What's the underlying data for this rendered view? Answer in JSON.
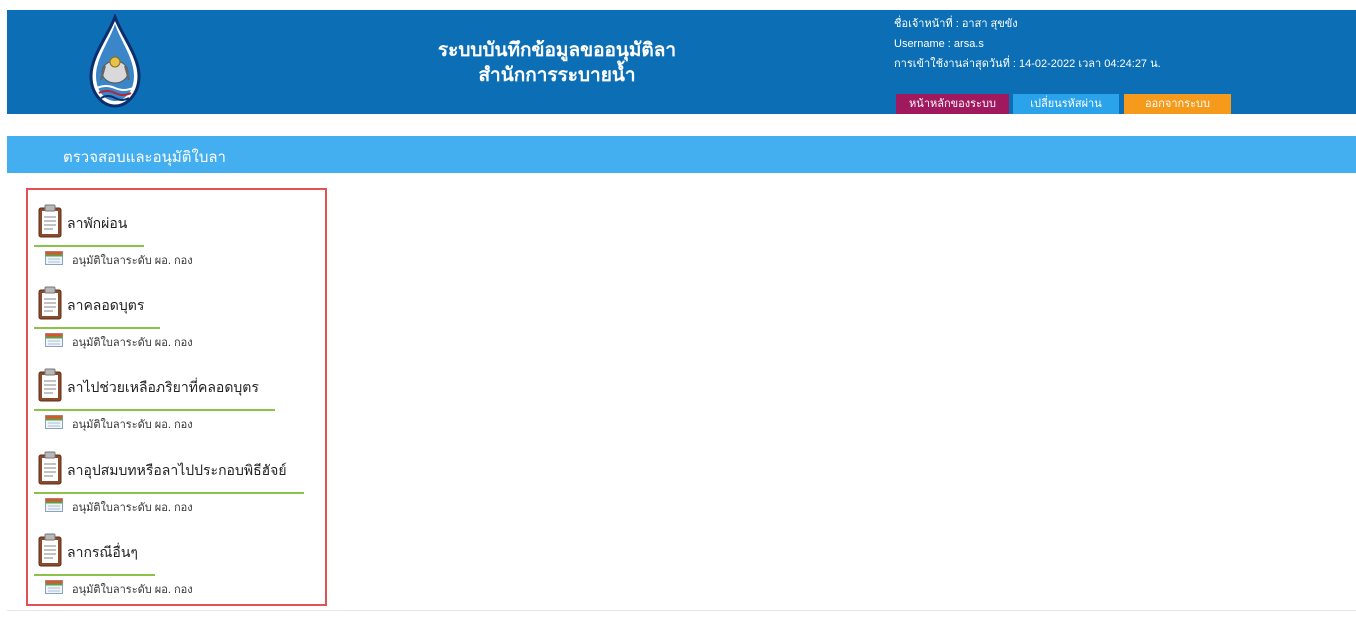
{
  "header": {
    "title_line1": "ระบบบันทึกข้อมูลขออนุมัติลา",
    "title_line2": "สำนักการระบายน้ำ",
    "officer_label": "ชื่อเจ้าหน้าที่ : อาสา  สุขขัง",
    "username_label": "Username : arsa.s",
    "last_login_label": "การเข้าใช้งานล่าสุดวันที่ : 14-02-2022 เวลา 04:24:27 น.",
    "nav": {
      "home": "หน้าหลักของระบบ",
      "change_password": "เปลี่ยนรหัสผ่าน",
      "logout": "ออกจากระบบ"
    }
  },
  "section": {
    "title": "ตรวจสอบและอนุมัติใบลา"
  },
  "leave_types": [
    {
      "label": "ลาพักผ่อน",
      "approve_label": "อนุมัติใบลาระดับ ผอ. กอง"
    },
    {
      "label": "ลาคลอดบุตร",
      "approve_label": "อนุมัติใบลาระดับ ผอ. กอง"
    },
    {
      "label": "ลาไปช่วยเหลือภริยาที่คลอดบุตร",
      "approve_label": "อนุมัติใบลาระดับ ผอ. กอง"
    },
    {
      "label": "ลาอุปสมบทหรือลาไปประกอบพิธีฮัจย์",
      "approve_label": "อนุมัติใบลาระดับ ผอ. กอง"
    },
    {
      "label": "ลากรณีอื่นๆ",
      "approve_label": "อนุมัติใบลาระดับ ผอ. กอง"
    }
  ],
  "colors": {
    "header_bg": "#0c6fb5",
    "section_bg": "#43aef0",
    "home_button": "#a0185e",
    "password_button": "#2aa3ea",
    "logout_button": "#f59a1b",
    "highlight_border": "#e05353",
    "underline": "#8bc34a"
  },
  "icons": {
    "logo": "department-emblem",
    "leave_item": "clipboard-icon",
    "approve_item": "document-icon"
  }
}
